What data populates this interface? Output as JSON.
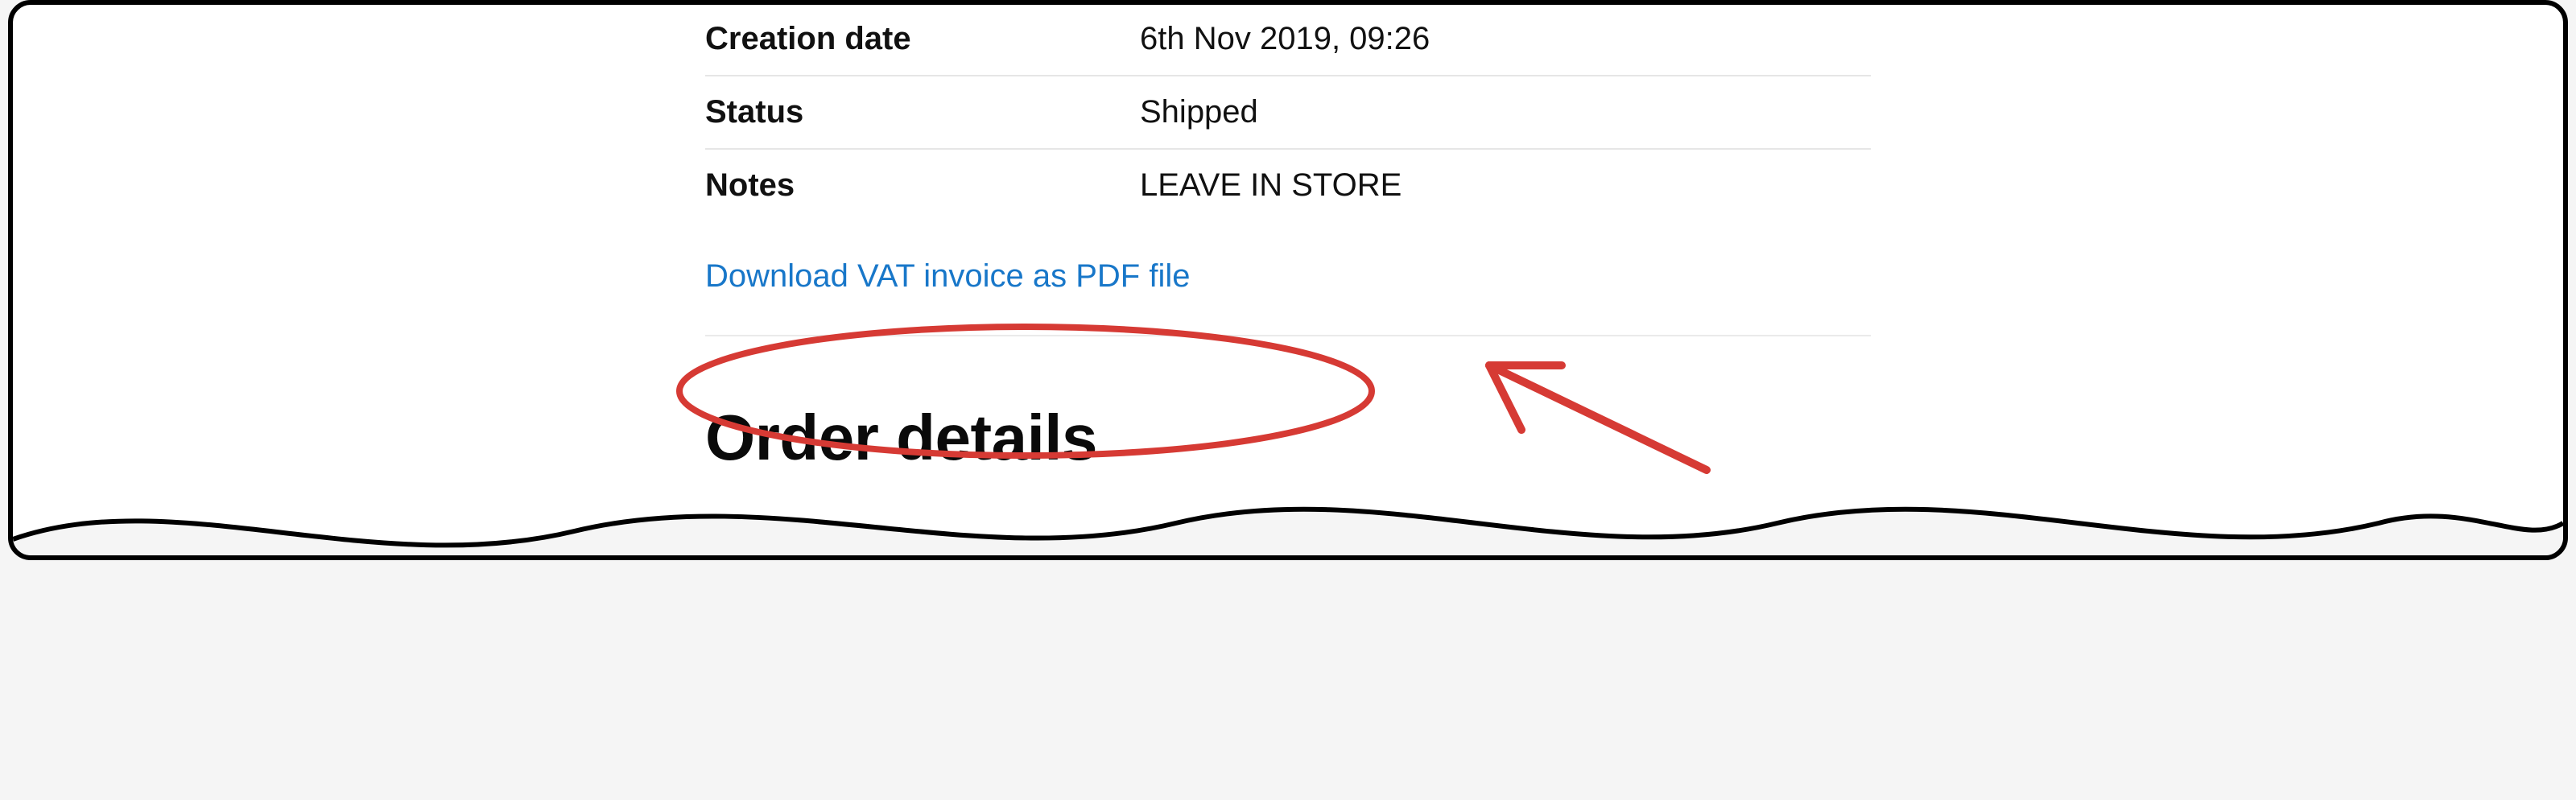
{
  "summary": {
    "rows": [
      {
        "label": "Creation date",
        "value": "6th Nov 2019, 09:26"
      },
      {
        "label": "Status",
        "value": "Shipped"
      },
      {
        "label": "Notes",
        "value": "LEAVE IN STORE"
      }
    ],
    "download_link_text": "Download VAT invoice as PDF file"
  },
  "section_heading": "Order details",
  "colors": {
    "link": "#1877c9",
    "annotation": "#d63a34"
  }
}
